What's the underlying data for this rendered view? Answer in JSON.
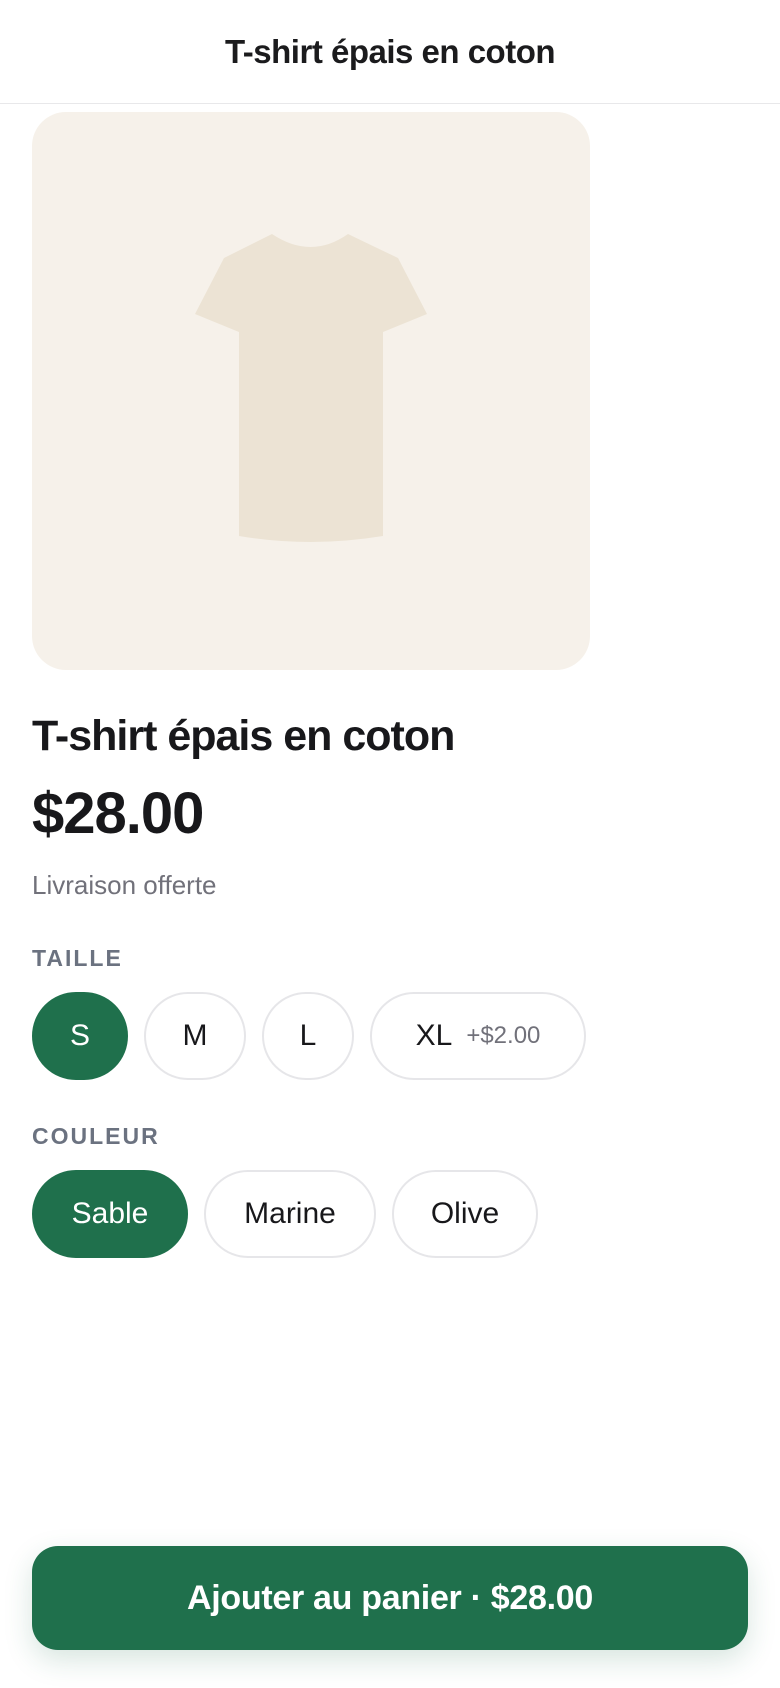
{
  "navbar": {
    "title": "T-shirt épais en coton"
  },
  "product": {
    "image_icon": "tshirt-illustration",
    "title": "T-shirt épais en coton",
    "price": "$28.00",
    "shipping": "Livraison offerte"
  },
  "size": {
    "label": "TAILLE",
    "options": [
      {
        "label": "S",
        "selected": true
      },
      {
        "label": "M",
        "selected": false
      },
      {
        "label": "L",
        "selected": false
      },
      {
        "label": "XL",
        "extra": "+$2.00",
        "selected": false
      }
    ]
  },
  "color": {
    "label": "COULEUR",
    "options": [
      {
        "label": "Sable",
        "selected": true
      },
      {
        "label": "Marine",
        "selected": false
      },
      {
        "label": "Olive",
        "selected": false
      }
    ]
  },
  "cart": {
    "label": "Ajouter au panier · $28.00"
  },
  "theme": {
    "accent": "#1f704c",
    "image_background": "#f6f1ea",
    "tshirt_fill": "#ece3d4",
    "muted_text": "#71717a"
  }
}
